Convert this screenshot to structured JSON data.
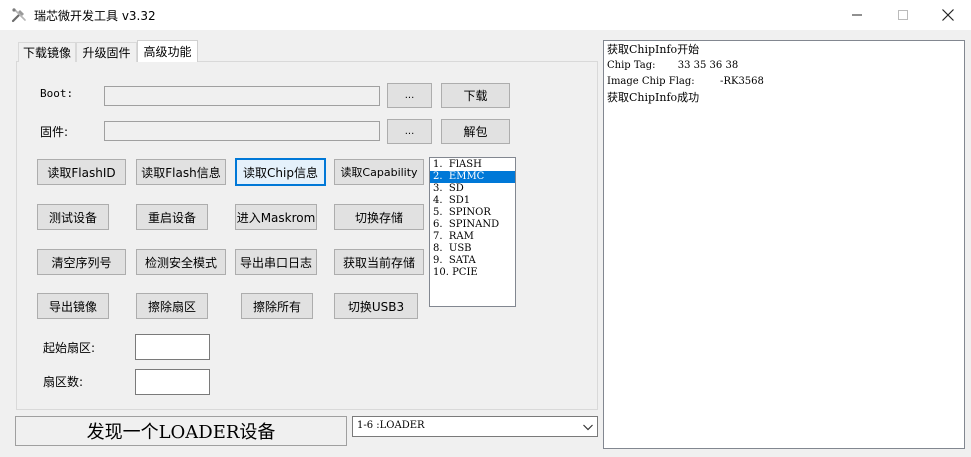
{
  "window": {
    "title": "瑞芯微开发工具 v3.32"
  },
  "tabs": [
    {
      "label": "下载镜像"
    },
    {
      "label": "升级固件"
    },
    {
      "label": "高级功能"
    }
  ],
  "form": {
    "boot_label": "Boot:",
    "boot_value": "",
    "boot_browse": "...",
    "download_button": "下载",
    "firmware_label": "固件:",
    "firmware_value": "",
    "firmware_browse": "...",
    "unpack_button": "解包",
    "start_sector_label": "起始扇区:",
    "start_sector_value": "",
    "sector_count_label": "扇区数:",
    "sector_count_value": ""
  },
  "actions": {
    "row1": [
      "读取FlashID",
      "读取Flash信息",
      "读取Chip信息",
      "读取Capability"
    ],
    "row2": [
      "测试设备",
      "重启设备",
      "进入Maskrom",
      "切换存储"
    ],
    "row3": [
      "清空序列号",
      "检测安全模式",
      "导出串口日志",
      "获取当前存储"
    ],
    "row4": [
      "导出镜像",
      "擦除扇区",
      "擦除所有",
      "切换USB3"
    ]
  },
  "storage_list": {
    "items": [
      "1.  FlASH",
      "2.  EMMC",
      "3.  SD",
      "4.  SD1",
      "5.  SPINOR",
      "6.  SPINAND",
      "7.  RAM",
      "8.  USB",
      "9.  SATA",
      "10. PCIE"
    ],
    "selected": "2.  EMMC"
  },
  "status": {
    "text": "发现一个LOADER设备"
  },
  "device_select": {
    "value": "1-6 :LOADER"
  },
  "log": {
    "lines": [
      "获取ChipInfo开始",
      "Chip Tag:       33 35 36 38",
      "Image Chip Flag:        -RK3568",
      "获取ChipInfo成功"
    ]
  },
  "colors": {
    "accent": "#0078d7",
    "window_bg": "#f0f0f0",
    "button_bg": "#e1e1e1"
  }
}
